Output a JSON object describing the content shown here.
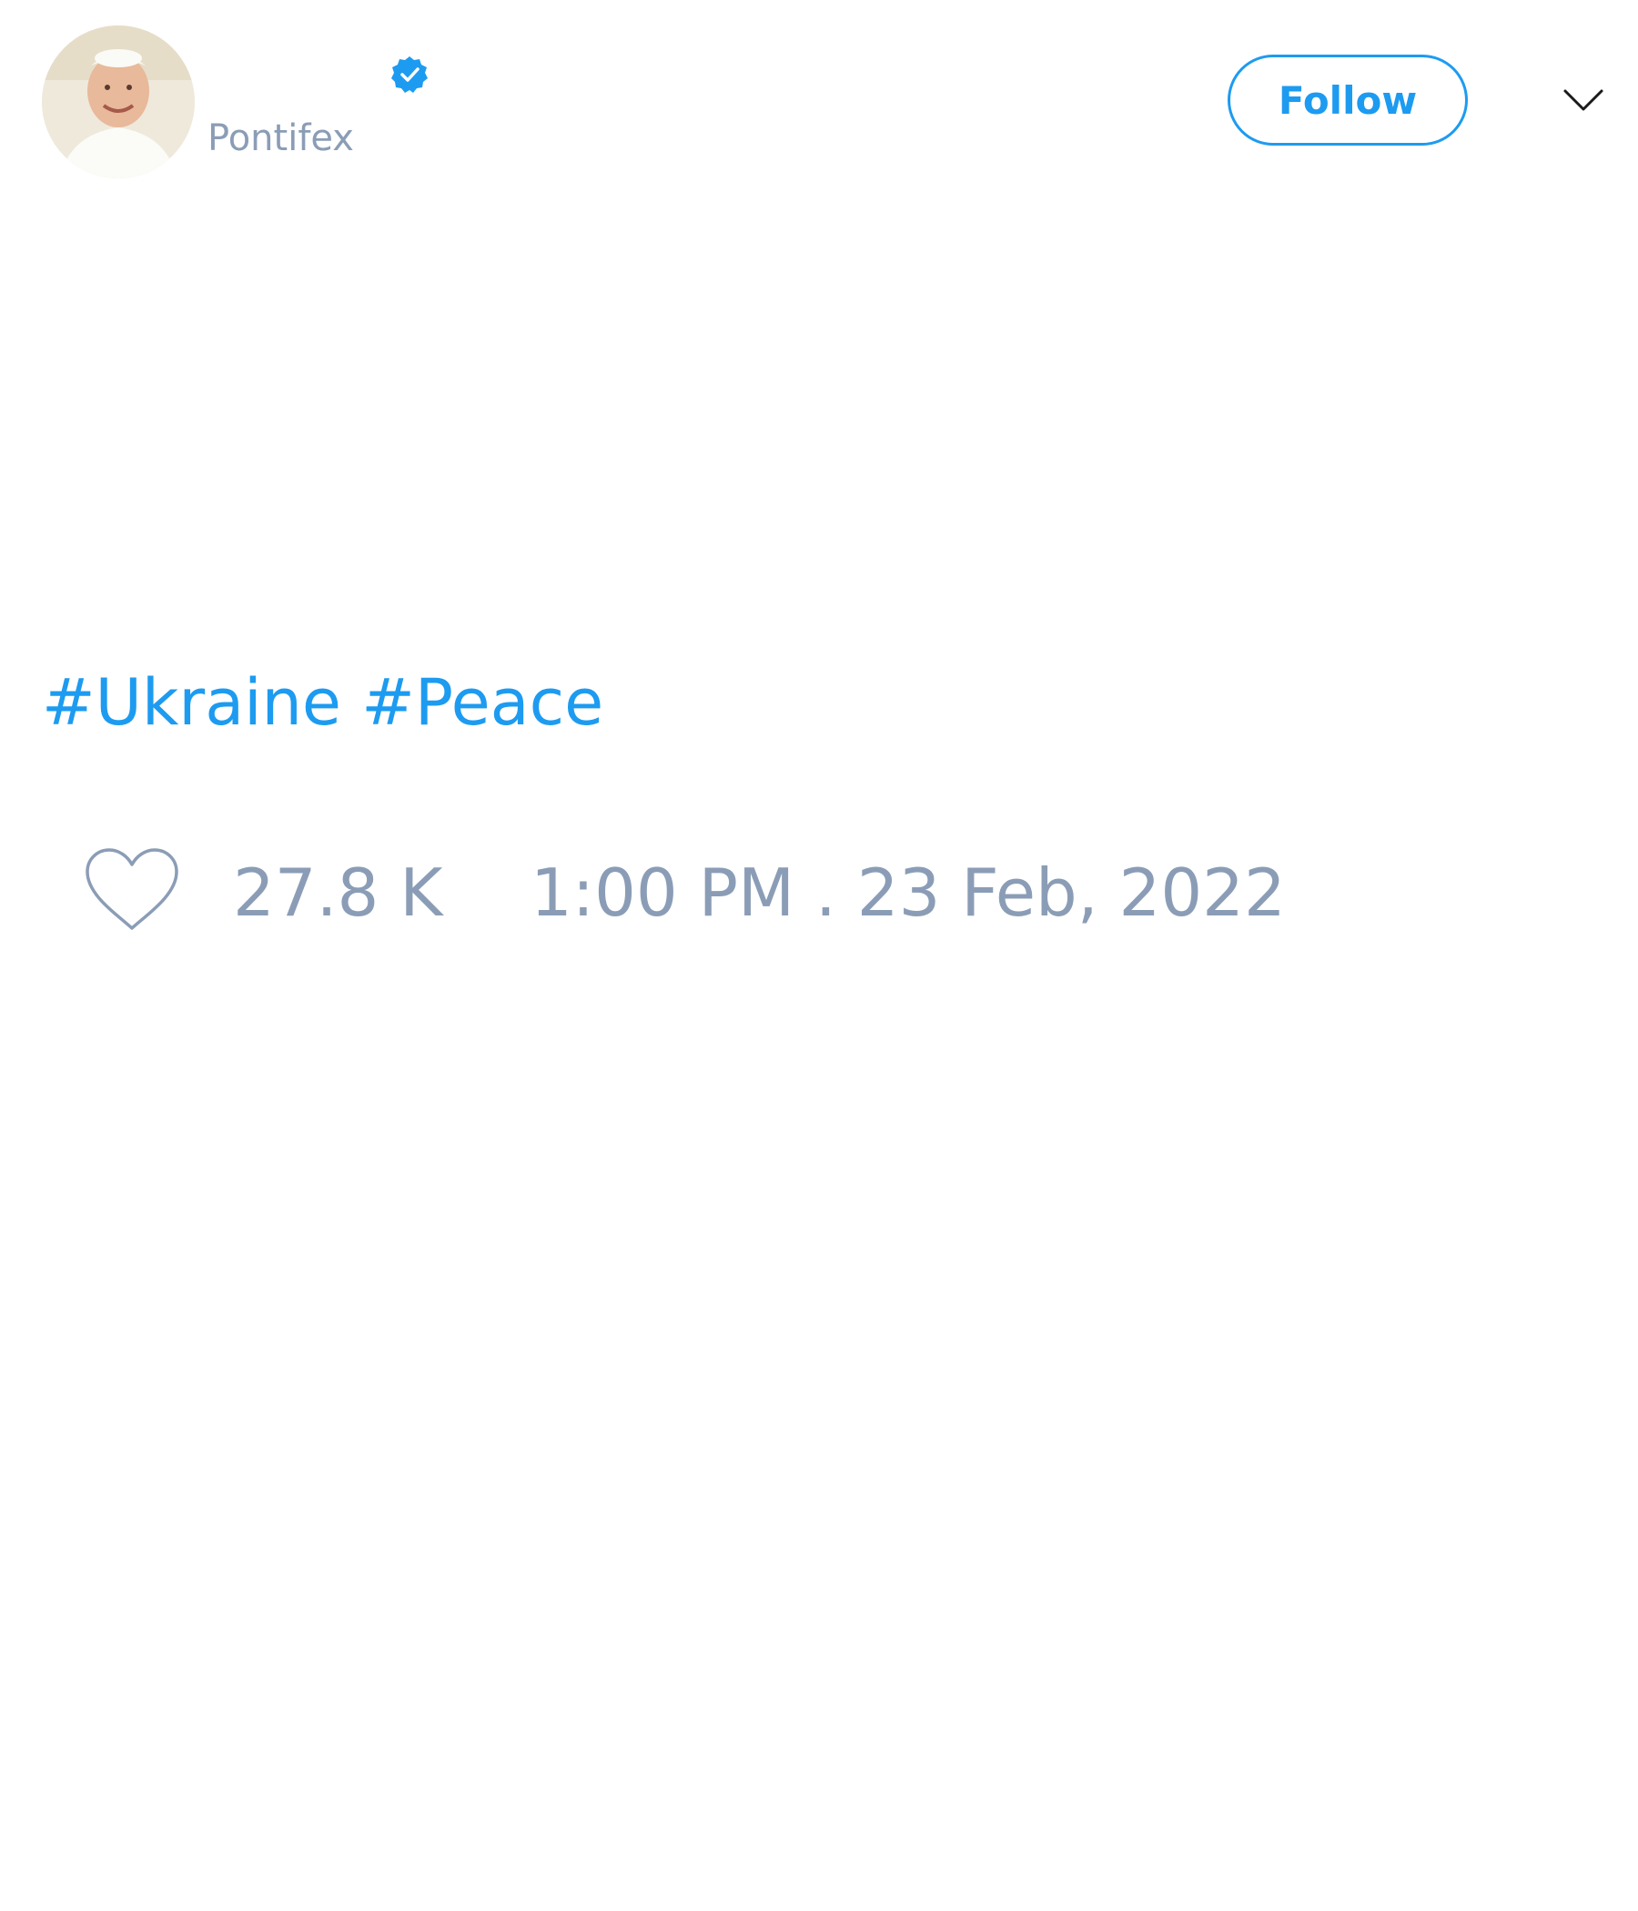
{
  "tweet": {
    "author": {
      "username": "Pontifex",
      "verified": true,
      "avatar_icon": "profile-photo"
    },
    "follow_label": "Follow",
    "menu_icon": "chevron-down-icon",
    "hashtags": [
      "#Ukraine",
      "#Peace"
    ],
    "likes": "27.8 K",
    "timestamp": "1:00 PM . 23 Feb, 2022"
  },
  "colors": {
    "accent": "#1d9bf0",
    "muted_text": "#8b9db6",
    "background": "#ffffff"
  }
}
